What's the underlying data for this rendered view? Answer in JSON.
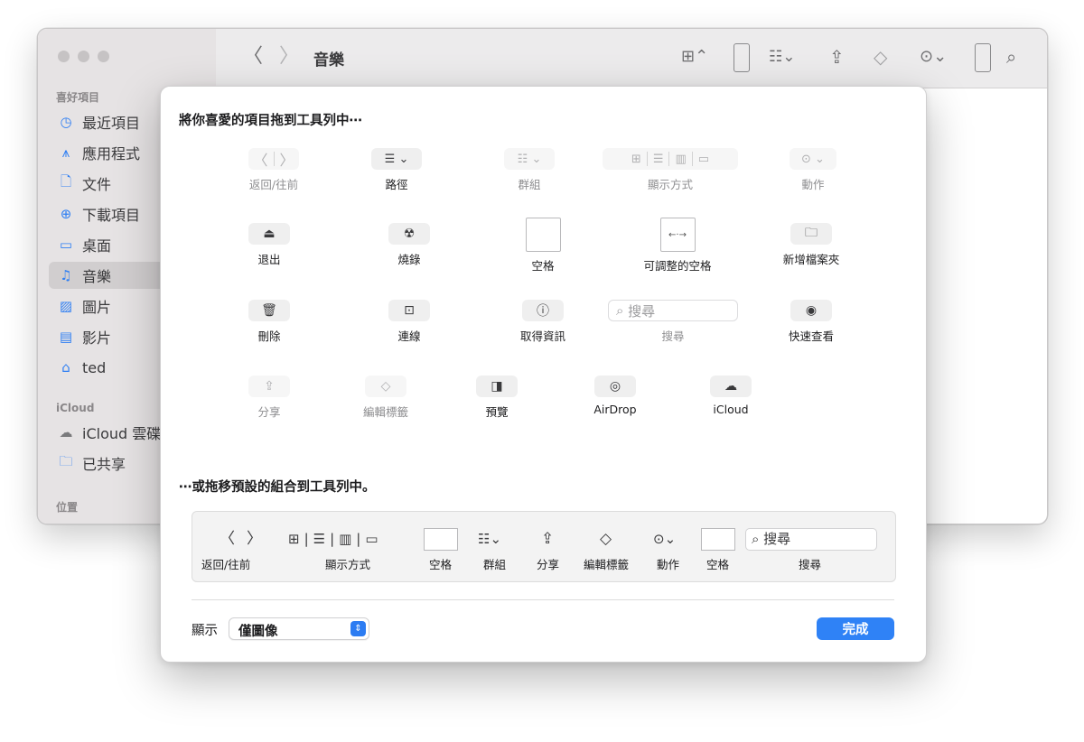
{
  "finder": {
    "title": "音樂",
    "sidebar": {
      "favorites_header": "喜好項目",
      "items": [
        {
          "label": "最近項目",
          "icon": "clock-icon"
        },
        {
          "label": "應用程式",
          "icon": "apps-icon"
        },
        {
          "label": "文件",
          "icon": "document-icon"
        },
        {
          "label": "下載項目",
          "icon": "download-icon"
        },
        {
          "label": "桌面",
          "icon": "desktop-icon"
        },
        {
          "label": "音樂",
          "icon": "music-icon",
          "selected": true
        },
        {
          "label": "圖片",
          "icon": "picture-icon"
        },
        {
          "label": "影片",
          "icon": "film-icon"
        },
        {
          "label": "ted",
          "icon": "home-icon"
        }
      ],
      "icloud_header": "iCloud",
      "icloud_items": [
        {
          "label": "iCloud 雲碟",
          "icon": "cloud-icon"
        },
        {
          "label": "已共享",
          "icon": "shared-folder-icon"
        }
      ],
      "locations_header": "位置"
    }
  },
  "sheet": {
    "title": "將你喜愛的項目拖到工具列中⋯",
    "tools": [
      {
        "label": "返回/往前",
        "icon": "back-forward-icon",
        "dim": true
      },
      {
        "label": "路徑",
        "icon": "path-icon",
        "dim": false
      },
      {
        "label": "群組",
        "icon": "group-icon",
        "dim": true
      },
      {
        "label": "顯示方式",
        "icon": "view-mode-icon",
        "dim": true
      },
      {
        "label": "動作",
        "icon": "action-icon",
        "dim": true
      },
      {
        "label": "退出",
        "icon": "eject-icon",
        "dim": false
      },
      {
        "label": "燒錄",
        "icon": "burn-icon",
        "dim": false
      },
      {
        "label": "空格",
        "icon": "space-icon",
        "dim": false
      },
      {
        "label": "可調整的空格",
        "icon": "flexible-space-icon",
        "dim": false
      },
      {
        "label": "新增檔案夾",
        "icon": "new-folder-icon",
        "dim": false
      },
      {
        "label": "刪除",
        "icon": "trash-icon",
        "dim": false
      },
      {
        "label": "連線",
        "icon": "connect-icon",
        "dim": false
      },
      {
        "label": "取得資訊",
        "icon": "info-icon",
        "dim": false
      },
      {
        "label": "搜尋",
        "icon": "search-icon",
        "dim": true,
        "placeholder": "搜尋"
      },
      {
        "label": "快速查看",
        "icon": "quicklook-icon",
        "dim": false
      },
      {
        "label": "分享",
        "icon": "share-icon",
        "dim": true
      },
      {
        "label": "編輯標籤",
        "icon": "tag-icon",
        "dim": true
      },
      {
        "label": "預覽",
        "icon": "preview-icon",
        "dim": false
      },
      {
        "label": "AirDrop",
        "icon": "airdrop-icon",
        "dim": false
      },
      {
        "label": "iCloud",
        "icon": "icloud-icon",
        "dim": false
      }
    ],
    "default_set_title": "⋯或拖移預設的組合到工具列中。",
    "default_set": {
      "labels": [
        "返回/往前",
        "顯示方式",
        "空格",
        "群組",
        "分享",
        "編輯標籤",
        "動作",
        "空格",
        "搜尋"
      ],
      "search_text": "搜尋"
    },
    "show_label": "顯示",
    "show_value": "僅圖像",
    "done_label": "完成"
  }
}
